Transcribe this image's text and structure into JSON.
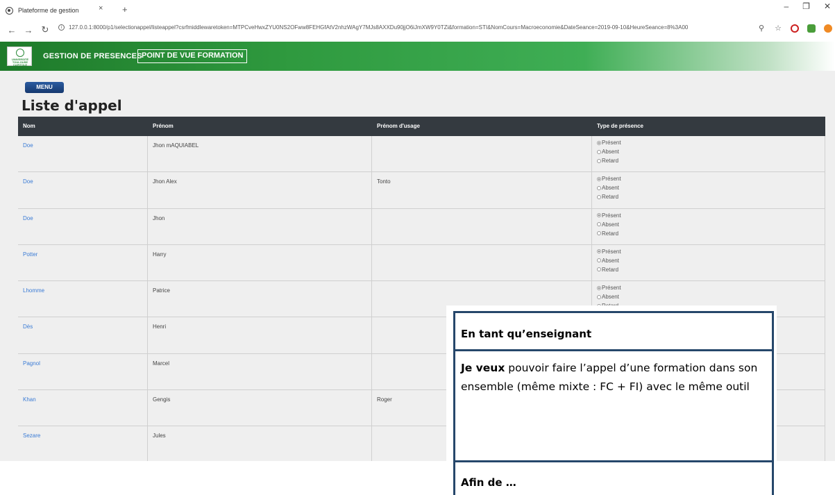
{
  "browser": {
    "tab_title": "Plateforme de gestion",
    "tab_close": "×",
    "new_tab": "+",
    "url": "127.0.0.1:8000/p1/selectionappel/listeappel?csrfmiddlewaretoken=MTPCveHwxZYU0NS2OFww8FEHGfAtV2nhzWAgY7MJs8AXXDu90jjO6iJmXW9Y0TZi&formation=STI&NomCours=Macroeconomie&DateSeance=2019-09-10&HeureSeance=8%3A00",
    "win_minimize": "–",
    "win_maximize": "❐",
    "win_close": "✕"
  },
  "header": {
    "logo_text": "UNIVERSITÉ TOULOUSE CAPITOLE",
    "title": "GESTION DE PRESENCES",
    "subtitle": "POINT DE VUE FORMATION"
  },
  "page": {
    "menu_label": "MENU",
    "title": "Liste d'appel"
  },
  "table": {
    "headers": [
      "Nom",
      "Prénom",
      "Prénom d'usage",
      "Type de présence"
    ],
    "presence_options": [
      "Présent",
      "Absent",
      "Retard"
    ],
    "rows": [
      {
        "nom": "Doe",
        "prenom": "Jhon mAQUIABEL",
        "usage": ""
      },
      {
        "nom": "Doe",
        "prenom": "Jhon Alex",
        "usage": "Tonto"
      },
      {
        "nom": "Doe",
        "prenom": "Jhon",
        "usage": ""
      },
      {
        "nom": "Potter",
        "prenom": "Harry",
        "usage": ""
      },
      {
        "nom": "Lhomme",
        "prenom": "Patrice",
        "usage": ""
      },
      {
        "nom": "Dès",
        "prenom": "Henri",
        "usage": ""
      },
      {
        "nom": "Pagnol",
        "prenom": "Marcel",
        "usage": ""
      },
      {
        "nom": "Khan",
        "prenom": "Gengis",
        "usage": "Roger"
      },
      {
        "nom": "Sezare",
        "prenom": "Jules",
        "usage": ""
      }
    ]
  },
  "story": {
    "role": "En tant qu’enseignant",
    "want_label": "Je veux",
    "want_text": " pouvoir faire l’appel d’une formation dans son ensemble (même mixte : FC + FI) avec le même outil",
    "goal": "Afin de …"
  }
}
